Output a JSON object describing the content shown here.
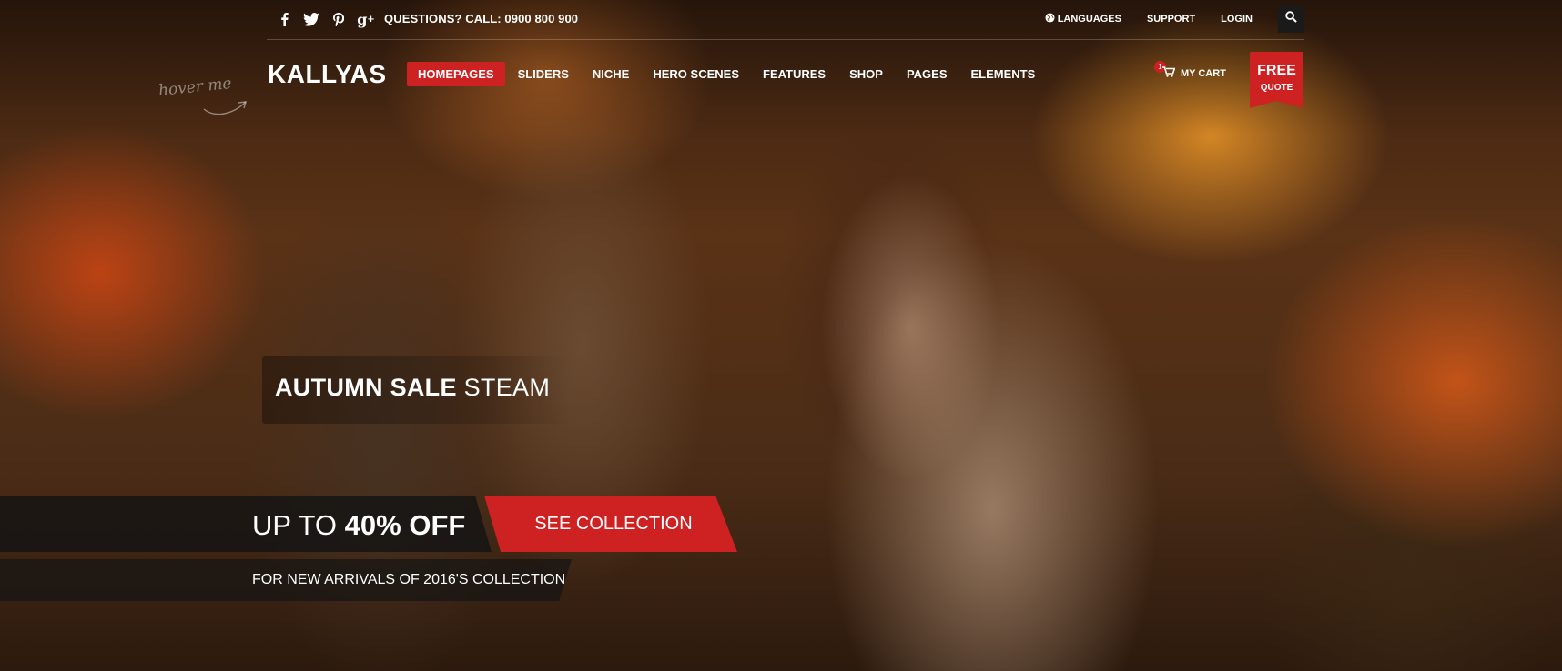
{
  "topbar": {
    "social": [
      {
        "icon": "facebook-icon",
        "glyph": "f"
      },
      {
        "icon": "twitter-icon",
        "glyph": "🐦"
      },
      {
        "icon": "pinterest-icon",
        "glyph": "P"
      },
      {
        "icon": "google-plus-icon",
        "glyph": "g+"
      }
    ],
    "phone_text": "QUESTIONS? CALL: 0900 800 900",
    "languages_label": "LANGUAGES",
    "support_label": "SUPPORT",
    "login_label": "LOGIN"
  },
  "header": {
    "logo": "KALLYAS",
    "hover_hint": "hover me",
    "nav": [
      {
        "label": "HOMEPAGES",
        "active": true
      },
      {
        "label": "SLIDERS"
      },
      {
        "label": "NICHE"
      },
      {
        "label": "HERO SCENES"
      },
      {
        "label": "FEATURES"
      },
      {
        "label": "SHOP"
      },
      {
        "label": "PAGES"
      },
      {
        "label": "ELEMENTS"
      }
    ],
    "cart_label": "MY CART",
    "cart_count": "1",
    "free_quote_top": "FREE",
    "free_quote_bottom": "QUOTE"
  },
  "hero": {
    "title_bold": "AUTUMN SALE",
    "title_rest": " STEAM",
    "offer_prefix": "UP TO ",
    "offer_bold": "40% OFF",
    "cta_label": "SEE COLLECTION",
    "subtitle": "FOR NEW ARRIVALS OF 2016'S COLLECTION"
  },
  "colors": {
    "accent": "#cd2122"
  }
}
